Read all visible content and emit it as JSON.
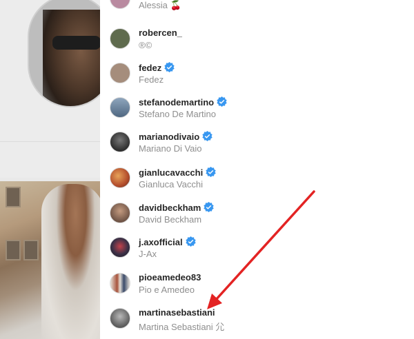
{
  "following": [
    {
      "username": "",
      "fullname": "Alessia 🍒",
      "verified": false,
      "avatar_color": "#b98aa0"
    },
    {
      "username": "robercen_",
      "fullname": "®©",
      "verified": false,
      "avatar_color": "#5f6b4e"
    },
    {
      "username": "fedez",
      "fullname": "Fedez",
      "verified": true,
      "avatar_color": "#a58d7c"
    },
    {
      "username": "stefanodemartino",
      "fullname": "Stefano De Martino",
      "verified": true,
      "avatar_color": "#6e8aa6"
    },
    {
      "username": "marianodivaio",
      "fullname": "Mariano Di Vaio",
      "verified": true,
      "avatar_color": "#3a3a3a"
    },
    {
      "username": "gianlucavacchi",
      "fullname": "Gianluca Vacchi",
      "verified": true,
      "avatar_color": "#c9673f"
    },
    {
      "username": "davidbeckham",
      "fullname": "David Beckham",
      "verified": true,
      "avatar_color": "#8c6e5c"
    },
    {
      "username": "j.axofficial",
      "fullname": "J-Ax",
      "verified": true,
      "avatar_color": "#3b3046"
    },
    {
      "username": "pioeamedeo83",
      "fullname": "Pio e Amedeo",
      "verified": false,
      "avatar_color": "#b8a28e"
    },
    {
      "username": "martinasebastiani",
      "fullname": "Martina Sebastiani ⺏",
      "verified": false,
      "avatar_color": "#707070"
    }
  ],
  "colors": {
    "verified_badge": "#3897f0",
    "annotation_arrow": "#e32323",
    "username": "#262626",
    "fullname": "#8e8e8e"
  },
  "icons": {
    "verified": "verified-badge-icon",
    "arrow": "red-arrow-annotation"
  }
}
